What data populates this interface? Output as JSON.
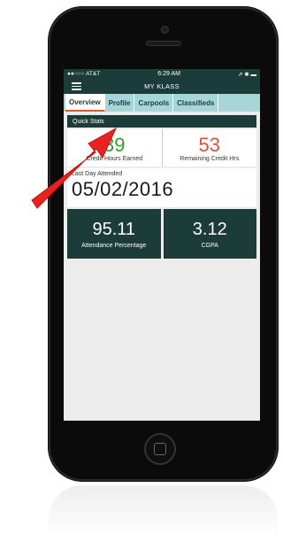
{
  "status_bar": {
    "carrier": "●●○○○ AT&T",
    "time": "6:29 AM",
    "right": "⇗ ✱ ▬"
  },
  "app": {
    "title": "MY KLASS"
  },
  "tabs": [
    "Overview",
    "Profile",
    "Carpools",
    "Classifieds"
  ],
  "section": {
    "title": "Quick Stats"
  },
  "credits": {
    "earned_value": "39",
    "earned_label": "Credit Hours Earned",
    "remaining_value": "53",
    "remaining_label": "Remaining Credit Hrs"
  },
  "last_day": {
    "label": "Last Day Attended",
    "date": "05/02/2016"
  },
  "stats": {
    "attendance_value": "95.11",
    "attendance_label": "Attendance Percentage",
    "cgpa_value": "3.12",
    "cgpa_label": "CGPA"
  },
  "colors": {
    "header": "#1c3c3a",
    "tab_bar": "#a7d6d8",
    "accent": "#e05a2a",
    "green": "#3a9a2a",
    "red": "#e0503a",
    "arrow": "#e8231f"
  }
}
